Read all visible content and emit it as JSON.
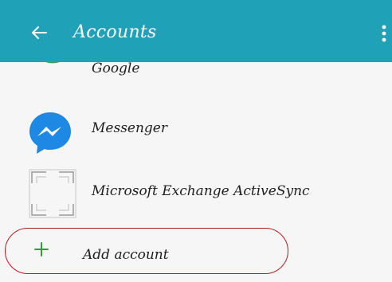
{
  "appbar": {
    "title": "Accounts",
    "back_icon": "back-arrow-icon",
    "menu_icon": "more-vert-icon",
    "color": "#1fa2b8"
  },
  "accounts": [
    {
      "label": "Google",
      "icon": "google-icon"
    },
    {
      "label": "Messenger",
      "icon": "messenger-icon"
    },
    {
      "label": "Microsoft Exchange ActiveSync",
      "icon": "exchange-icon"
    }
  ],
  "add_account": {
    "label": "Add account",
    "icon": "plus-icon",
    "accent": "#2e9e3a",
    "highlight": "#b31c1c"
  }
}
